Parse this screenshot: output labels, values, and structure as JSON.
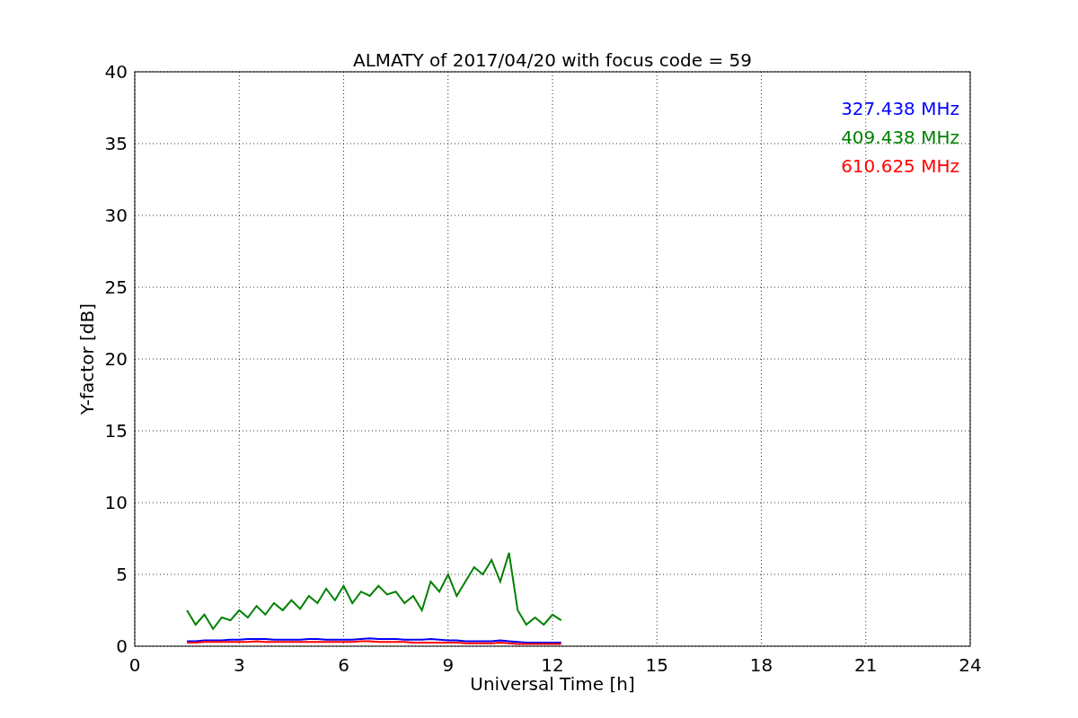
{
  "chart_data": {
    "type": "line",
    "title": "ALMATY of 2017/04/20 with focus code = 59",
    "xlabel": "Universal Time [h]",
    "ylabel": "Y-factor [dB]",
    "x": [
      1.5,
      1.75,
      2,
      2.25,
      2.5,
      2.75,
      3,
      3.25,
      3.5,
      3.75,
      4,
      4.25,
      4.5,
      4.75,
      5,
      5.25,
      5.5,
      5.75,
      6,
      6.25,
      6.5,
      6.75,
      7,
      7.25,
      7.5,
      7.75,
      8,
      8.25,
      8.5,
      8.75,
      9,
      9.25,
      9.5,
      9.75,
      10,
      10.25,
      10.5,
      10.75,
      11,
      11.25,
      11.5,
      11.75,
      12,
      12.25
    ],
    "series": [
      {
        "name": "327.438 MHz",
        "color": "#0000ff",
        "values": [
          0.35,
          0.35,
          0.4,
          0.4,
          0.4,
          0.45,
          0.45,
          0.5,
          0.5,
          0.5,
          0.45,
          0.45,
          0.45,
          0.45,
          0.5,
          0.5,
          0.45,
          0.45,
          0.45,
          0.45,
          0.5,
          0.55,
          0.5,
          0.5,
          0.5,
          0.45,
          0.45,
          0.45,
          0.5,
          0.45,
          0.4,
          0.4,
          0.35,
          0.35,
          0.35,
          0.35,
          0.4,
          0.35,
          0.3,
          0.25,
          0.25,
          0.25,
          0.25,
          0.25
        ]
      },
      {
        "name": "409.438 MHz",
        "color": "#008000",
        "values": [
          2.5,
          1.5,
          2.2,
          1.2,
          2.0,
          1.8,
          2.5,
          2.0,
          2.8,
          2.2,
          3.0,
          2.5,
          3.2,
          2.6,
          3.5,
          3.0,
          4.0,
          3.2,
          4.2,
          3.0,
          3.8,
          3.5,
          4.2,
          3.6,
          3.8,
          3.0,
          3.5,
          2.5,
          4.5,
          3.8,
          5.0,
          3.5,
          4.5,
          5.5,
          5.0,
          6.0,
          4.5,
          6.5,
          2.5,
          1.5,
          2.0,
          1.5,
          2.2,
          1.8
        ]
      },
      {
        "name": "610.625 MHz",
        "color": "#ff0000",
        "values": [
          0.25,
          0.25,
          0.3,
          0.3,
          0.3,
          0.3,
          0.3,
          0.3,
          0.35,
          0.3,
          0.3,
          0.3,
          0.3,
          0.3,
          0.3,
          0.3,
          0.3,
          0.3,
          0.3,
          0.3,
          0.35,
          0.35,
          0.3,
          0.3,
          0.3,
          0.3,
          0.25,
          0.25,
          0.25,
          0.25,
          0.25,
          0.25,
          0.2,
          0.2,
          0.2,
          0.2,
          0.25,
          0.2,
          0.15,
          0.15,
          0.15,
          0.15,
          0.15,
          0.15
        ]
      }
    ],
    "grid": true,
    "xlim": [
      0,
      24
    ],
    "ylim": [
      0,
      40
    ],
    "xticks": [
      0,
      3,
      6,
      9,
      12,
      15,
      18,
      21,
      24
    ],
    "yticks": [
      0,
      5,
      10,
      15,
      20,
      25,
      30,
      35,
      40
    ]
  }
}
